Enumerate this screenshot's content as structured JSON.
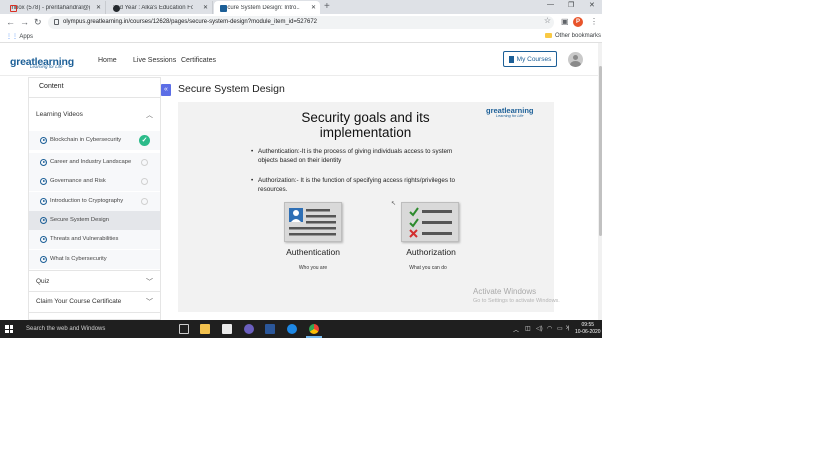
{
  "browser": {
    "tabs": [
      {
        "label": "Inbox (578) - preritahandral@g...",
        "icon": "gmail-icon"
      },
      {
        "label": "2nd Year : Alka's Education Foun...",
        "icon": "github-icon"
      },
      {
        "label": "Secure System Design: Intro...",
        "icon": "greatlearning-icon",
        "active": true
      }
    ],
    "url": "olympus.greatlearning.in/courses/12628/pages/secure-system-design?module_item_id=527672",
    "bookmarks": {
      "apps": "Apps",
      "other": "Other bookmarks"
    },
    "profile_initial": "P"
  },
  "header": {
    "logo": {
      "main": "greatlearning",
      "tagline": "Learning for Life"
    },
    "nav": [
      "Home",
      "Live Sessions",
      "Certificates"
    ],
    "my_courses": "My Courses"
  },
  "sidebar": {
    "title": "Content",
    "sections": {
      "learning_videos": "Learning Videos",
      "quiz": "Quiz",
      "certificate": "Claim Your Course Certificate"
    },
    "items": [
      {
        "label": "Blockchain in Cybersecurity",
        "status": "complete"
      },
      {
        "label": "Career and Industry Landscape",
        "status": "pending"
      },
      {
        "label": "Governance and Risk",
        "status": "pending"
      },
      {
        "label": "Introduction to Cryptography",
        "status": "pending"
      },
      {
        "label": "Secure System Design",
        "status": "current"
      },
      {
        "label": "Threats and Vulnerabilities",
        "status": "none"
      },
      {
        "label": "What Is Cybersecurity",
        "status": "none"
      }
    ]
  },
  "main": {
    "page_title": "Secure System Design",
    "slide": {
      "title_line1": "Security goals and its",
      "title_line2": "implementation",
      "logo": "greatlearning",
      "logo_tag": "Learning for Life",
      "bullet1": "Authentication:-It is the process of giving individuals access to system objects based on their identity",
      "bullet2": "Authorization:- It is the function of specifying access rights/privileges to resources.",
      "auth_label": "Authentication",
      "auth_sub": "Who you are",
      "authz_label": "Authorization",
      "authz_sub": "What you can do"
    },
    "watermark_line1": "Activate Windows",
    "watermark_line2": "Go to Settings to activate Windows."
  },
  "taskbar": {
    "search": "Search the web and Windows",
    "time": "09:55",
    "date": "10-06-2020"
  },
  "colors": {
    "brand": "#1c5f97",
    "complete": "#2bbb8a",
    "collapse": "#5c6ee6"
  }
}
